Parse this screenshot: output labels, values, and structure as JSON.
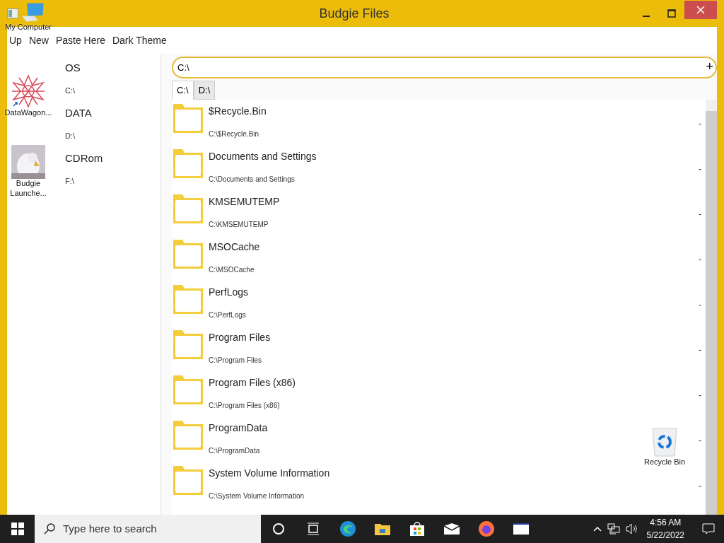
{
  "window": {
    "title": "Budgie Files"
  },
  "menu": [
    "Up",
    "New",
    "Paste Here",
    "Dark Theme"
  ],
  "drives": [
    {
      "name": "OS",
      "path": "C:\\"
    },
    {
      "name": "DATA",
      "path": "D:\\"
    },
    {
      "name": "CDRom",
      "path": "F:\\"
    }
  ],
  "address": {
    "value": "C:\\",
    "add_button": "+"
  },
  "tabs": [
    {
      "label": "C:\\",
      "selected": true
    },
    {
      "label": "D:\\",
      "selected": false
    }
  ],
  "items": [
    {
      "name": "$Recycle.Bin",
      "path": "C:\\$Recycle.Bin",
      "size": "-"
    },
    {
      "name": "Documents and Settings",
      "path": "C:\\Documents and Settings",
      "size": "-"
    },
    {
      "name": "KMSEMUTEMP",
      "path": "C:\\KMSEMUTEMP",
      "size": "-"
    },
    {
      "name": "MSOCache",
      "path": "C:\\MSOCache",
      "size": "-"
    },
    {
      "name": "PerfLogs",
      "path": "C:\\PerfLogs",
      "size": "-"
    },
    {
      "name": "Program Files",
      "path": "C:\\Program Files",
      "size": "-"
    },
    {
      "name": "Program Files (x86)",
      "path": "C:\\Program Files (x86)",
      "size": "-"
    },
    {
      "name": "ProgramData",
      "path": "C:\\ProgramData",
      "size": "-"
    },
    {
      "name": "System Volume Information",
      "path": "C:\\System Volume Information",
      "size": "-"
    }
  ],
  "desktop_icons": [
    {
      "kind": "computer",
      "label": "My Computer"
    },
    {
      "kind": "app",
      "label": "DataWagon..."
    },
    {
      "kind": "picture",
      "label": "Budgie Launche..."
    },
    {
      "kind": "recycle",
      "label": "Recycle Bin"
    }
  ],
  "taskbar": {
    "search_placeholder": "Type here to search",
    "time": "4:56 AM",
    "date": "5/22/2022"
  }
}
